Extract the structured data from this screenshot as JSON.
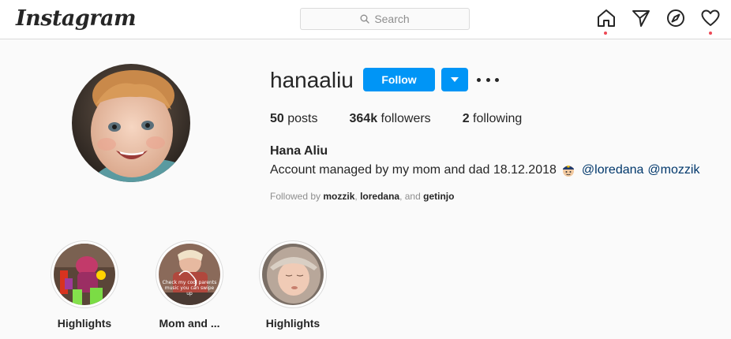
{
  "nav": {
    "logo": "Instagram",
    "search_placeholder": "Search",
    "icons": [
      "home-icon",
      "direct-icon",
      "explore-icon",
      "activity-icon"
    ]
  },
  "profile": {
    "username": "hanaaliu",
    "follow_label": "Follow",
    "stats": {
      "posts_count": "50",
      "posts_label": "posts",
      "followers_count": "364k",
      "followers_label": "followers",
      "following_count": "2",
      "following_label": "following"
    },
    "full_name": "Hana Aliu",
    "bio_text": "Account managed by my mom and dad 18.12.2018",
    "bio_mentions": [
      "@loredana",
      "@mozzik"
    ],
    "followed_by": {
      "prefix": "Followed by",
      "users": [
        "mozzik",
        "loredana",
        "getinjo"
      ],
      "sep": ",",
      "and": ", and"
    }
  },
  "highlights": [
    {
      "label": "Highlights"
    },
    {
      "label": "Mom and ...",
      "overlay_text": "Check my cool parents music you can swipe up"
    },
    {
      "label": "Highlights"
    }
  ],
  "colors": {
    "accent": "#0095f6",
    "notification_dot": "#ed4956",
    "mention": "#00376b"
  }
}
